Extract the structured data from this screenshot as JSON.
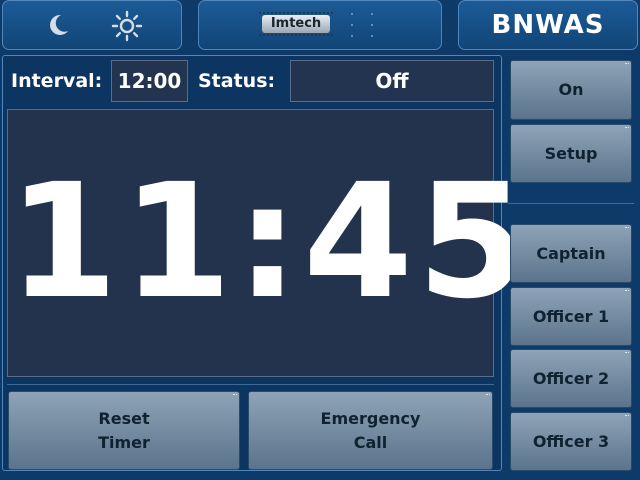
{
  "header": {
    "title": "BNWAS",
    "logo_text": "Imtech",
    "night_mode_icon": "moon-icon",
    "day_mode_icon": "sun-icon"
  },
  "status_bar": {
    "interval_label": "Interval:",
    "interval_value": "12:00",
    "status_label": "Status:",
    "status_value": "Off"
  },
  "timer": {
    "display": "11:45"
  },
  "actions": {
    "reset_line1": "Reset",
    "reset_line2": "Timer",
    "emergency_line1": "Emergency",
    "emergency_line2": "Call"
  },
  "side_buttons": {
    "on": "On",
    "setup": "Setup",
    "captain": "Captain",
    "officer1": "Officer 1",
    "officer2": "Officer 2",
    "officer3": "Officer 3"
  },
  "colors": {
    "background": "#0d3a68",
    "panel": "#1c5b97",
    "display_bg": "#23334d",
    "button": "#8ea3b6"
  }
}
